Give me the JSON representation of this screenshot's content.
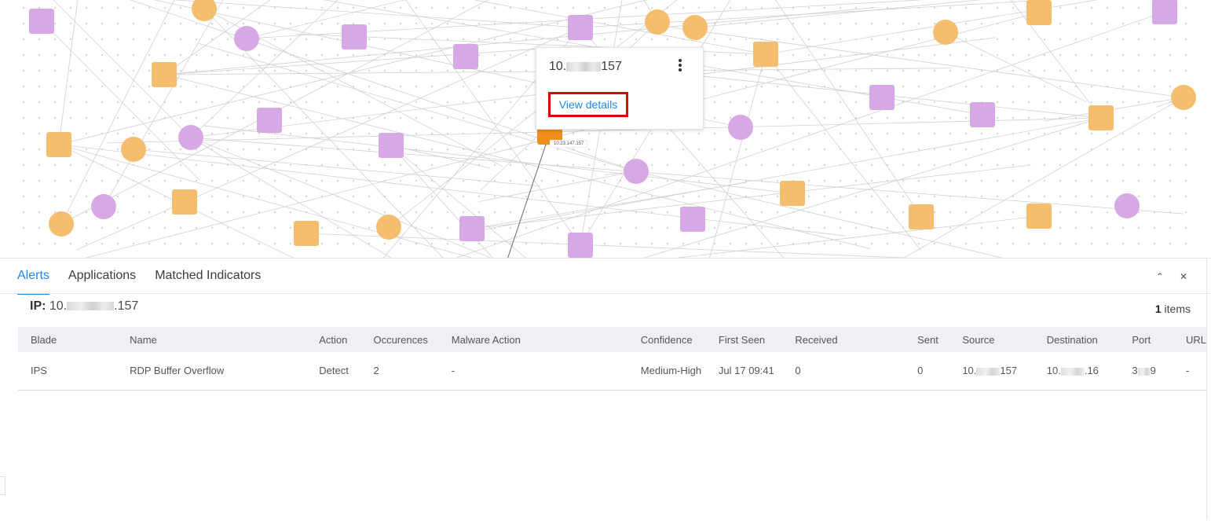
{
  "popup": {
    "ip_prefix": "10.",
    "ip_suffix": "157",
    "view_details": "View details"
  },
  "node_label": "10.23.147.157",
  "colors": {
    "orange": "#f5bd6e",
    "purple": "#d7a8e3",
    "accent": "#1e88e5",
    "highlight": "#e00000",
    "selected_node": "#ef8e1c"
  },
  "tabs": [
    "Alerts",
    "Applications",
    "Matched Indicators"
  ],
  "panel_icons": {
    "collapse": "chevron-up-icon",
    "close": "close-icon"
  },
  "ip_filter": {
    "label": "IP:",
    "prefix": "10.",
    "suffix": ".157"
  },
  "items": {
    "count": "1",
    "label": "items"
  },
  "table": {
    "headers": [
      "Blade",
      "Name",
      "Action",
      "Occurences",
      "Malware Action",
      "Confidence",
      "First Seen",
      "Received",
      "Sent",
      "Source",
      "Destination",
      "Port",
      "URL"
    ],
    "row": {
      "blade": "IPS",
      "name": "RDP Buffer Overflow",
      "action": "Detect",
      "occurences": "2",
      "malware_action": "-",
      "confidence": "Medium-High",
      "first_seen": "Jul 17 09:41",
      "received": "0",
      "sent": "0",
      "source_prefix": "10.",
      "source_suffix": "157",
      "destination_prefix": "10.",
      "destination_suffix": ".16",
      "port_prefix": "3",
      "port_suffix": "9",
      "url": "-"
    }
  }
}
